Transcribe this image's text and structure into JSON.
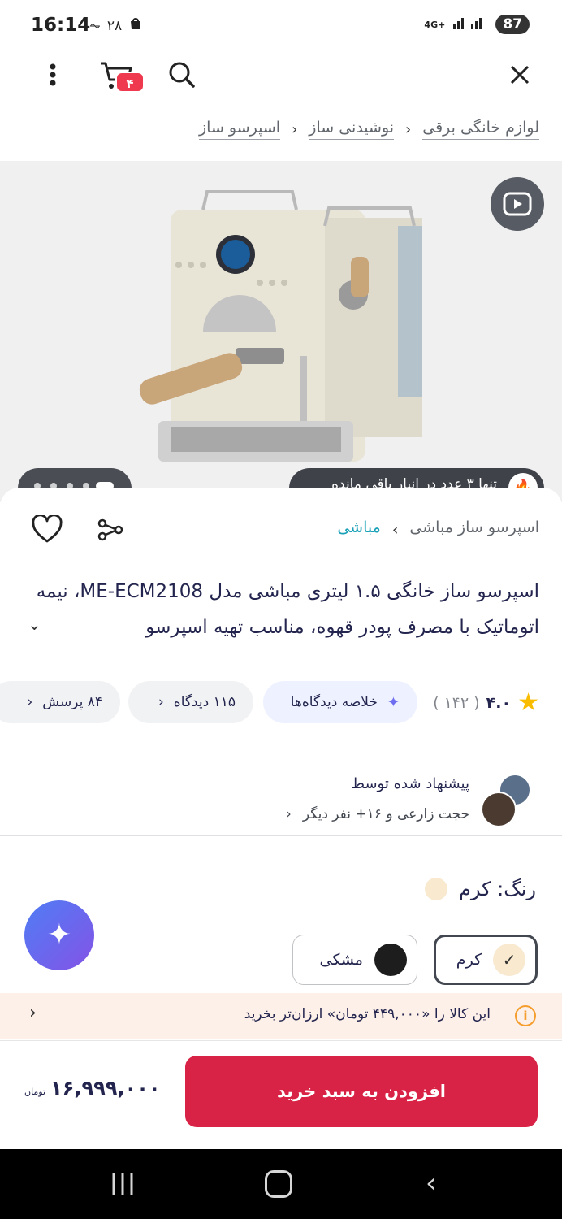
{
  "status_bar": {
    "time": "16:14",
    "temperature": "۲۸",
    "network": "4G+",
    "battery": "87"
  },
  "app_bar": {
    "cart_count": "۴",
    "icons": [
      "close-icon",
      "search-icon",
      "cart-icon",
      "more-vertical-icon"
    ]
  },
  "breadcrumb": {
    "items": [
      "لوازم خانگی برقی",
      "نوشیدنی ساز",
      "اسپرسو ساز"
    ]
  },
  "gallery": {
    "stock_notice": "تنها ۳ عدد در انبار باقی مانده"
  },
  "product": {
    "brand_crumbs": [
      "مباشی",
      "اسپرسو ساز مباشی"
    ],
    "title": "اسپرسو ساز خانگی ۱.۵ لیتری مباشی مدل ME-ECM2108، نیمه اتوماتیک با مصرف پودر قهوه، مناسب تهیه اسپرسو",
    "rating": "۴.۰",
    "rating_count": "( ۱۴۲ )",
    "summary_chip": "خلاصه دیدگاه‌ها",
    "reviews_chip": "۱۱۵ دیدگاه",
    "questions_chip": "۸۴ پرسش"
  },
  "recommendation": {
    "title": "پیشنهاد شده توسط",
    "subtitle": "حجت زارعی و ۱۶+ نفر دیگر"
  },
  "color": {
    "label": "رنگ: کرم",
    "options": [
      "کرم",
      "مشکی"
    ],
    "selected": "کرم",
    "swatches": {
      "cream": "#f8e9cf",
      "black": "#1d1d1d"
    }
  },
  "cheaper_offer": {
    "text": "این کالا را «۴۴۹,۰۰۰ تومان» ارزان‌تر بخرید"
  },
  "buy_bar": {
    "add_to_cart": "افزودن به سبد خرید",
    "price": "۱۶,۹۹۹,۰۰۰",
    "currency": "تومان"
  },
  "theme": {
    "primary": "#d82246",
    "badge": "#ef394e",
    "link": "#19a1b8",
    "star": "#f9bc00"
  }
}
